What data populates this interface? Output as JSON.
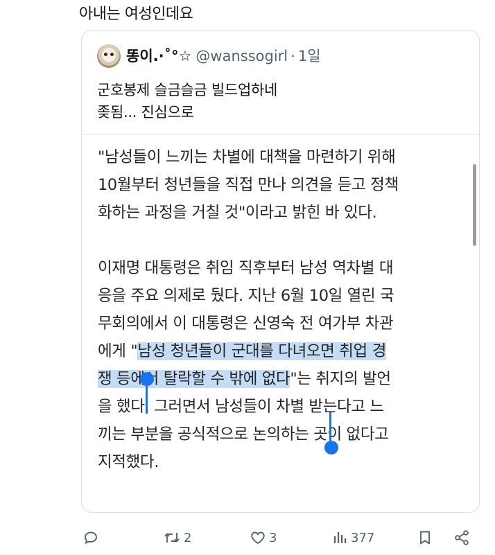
{
  "comment_text": "아내는 여성인데요",
  "quoted_tweet": {
    "author_name": "똥이.·˚°☆",
    "author_handle": "@wanssogirl",
    "separator": "·",
    "time": "1일",
    "text_lines": [
      "군호봉제 슬금슬금 빌드업하네",
      "좆됨... 진심으로"
    ]
  },
  "article": {
    "lines": [
      "\"남성들이 느끼는 차별에 대책을 마련하기 위해",
      "10월부터 청년들을 직접 만나 의견을 듣고 정책",
      "화하는 과정을 거칠 것\"이라고 밝힌 바 있다.",
      "",
      "이재명 대통령은 취임 직후부터 남성 역차별 대",
      "응을 주요 의제로 뒀다. 지난 6월 10일 열린 국",
      "무회의에서 이 대통령은 신영숙 전 여가부 차관"
    ],
    "line8_prefix": "에게 \"",
    "line8_highlight": "남성 청년들이 군대를 다녀오면 취업 경",
    "line9_highlight": "쟁 등에서 탈락할 수 밖에 없다",
    "line9_suffix": "\"는 취지의 발언",
    "lines_after": [
      "을 했다. 그러면서 남성들이 차별 받는다고 느",
      "끼는 부분을 공식적으로 논의하는 곳이 없다고",
      "지적했다."
    ],
    "highlight_color": "#c5dcf6",
    "handle_color": "#1a73e8"
  },
  "actions": {
    "reply_count": "",
    "retweet_count": "2",
    "like_count": "3",
    "view_count": "377"
  },
  "icons": [
    "reply-icon",
    "retweet-icon",
    "like-icon",
    "views-icon",
    "bookmark-icon",
    "share-icon"
  ]
}
